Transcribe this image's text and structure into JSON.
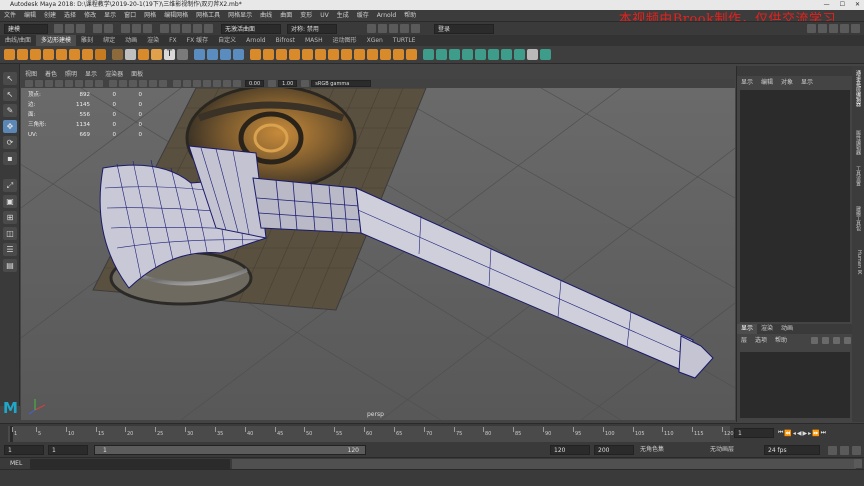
{
  "window": {
    "title": "Autodesk Maya 2018: D:\\课程教学\\2019-20-1(19下)\\三维影视制作\\双刃斧X2.mb*",
    "controls": [
      "—",
      "☐",
      "✕"
    ]
  },
  "menubar": {
    "items": [
      "文件",
      "编辑",
      "创建",
      "选择",
      "修改",
      "显示",
      "窗口",
      "网格",
      "编辑网格",
      "网格工具",
      "网格显示",
      "曲线",
      "曲面",
      "变形",
      "UV",
      "生成",
      "缓存",
      "Arnold",
      "帮助"
    ]
  },
  "watermark": "本视频由Brook制作，仅供交流学习",
  "statusline": {
    "mode": "建模",
    "no_live_surface": "无激活曲面",
    "symmetry": "对称: 禁用",
    "login": "登录"
  },
  "shelf": {
    "tabs": [
      "曲线/曲面",
      "多边形建模",
      "雕刻",
      "绑定",
      "动画",
      "渲染",
      "FX",
      "FX 缓存",
      "自定义",
      "Arnold",
      "Bifrost",
      "MASH",
      "运动图形",
      "XGen",
      "TURTLE"
    ],
    "active_tab": "多边形建模"
  },
  "viewport": {
    "menu": [
      "视图",
      "着色",
      "照明",
      "显示",
      "渲染器",
      "面板"
    ],
    "exposure": "0.00",
    "gamma": "1.00",
    "colorspace": "sRGB gamma",
    "camera_label": "persp",
    "hud": [
      {
        "label": "顶点:",
        "a": "892",
        "b": "0",
        "c": "0"
      },
      {
        "label": "边:",
        "a": "1145",
        "b": "0",
        "c": "0"
      },
      {
        "label": "面:",
        "a": "556",
        "b": "0",
        "c": "0"
      },
      {
        "label": "三角形:",
        "a": "1134",
        "b": "0",
        "c": "0"
      },
      {
        "label": "UV:",
        "a": "669",
        "b": "0",
        "c": "0"
      }
    ]
  },
  "right_panel": {
    "menu": [
      "显示",
      "编辑",
      "对象",
      "显示"
    ],
    "layer_tabs": [
      "显示",
      "渲染",
      "动画"
    ],
    "layer_menu": [
      "层",
      "选项",
      "帮助"
    ],
    "side_tabs": [
      "通道盒/层编辑器",
      "属性编辑器",
      "工具设置",
      "建模工具包",
      "Human IK"
    ]
  },
  "timeline": {
    "ticks": [
      "1",
      "5",
      "10",
      "15",
      "20",
      "25",
      "30",
      "35",
      "40",
      "45",
      "50",
      "55",
      "60",
      "65",
      "70",
      "75",
      "80",
      "85",
      "90",
      "95",
      "100",
      "105",
      "110",
      "115",
      "120"
    ],
    "current_frame": "1"
  },
  "range": {
    "start": "1",
    "anim_start": "1",
    "range_start_label": "1",
    "range_end_label": "120",
    "end": "120",
    "anim_end": "200",
    "char_set": "无角色集",
    "anim_layer": "无动画层",
    "fps": "24 fps"
  },
  "cmdline": {
    "label": "MEL"
  }
}
